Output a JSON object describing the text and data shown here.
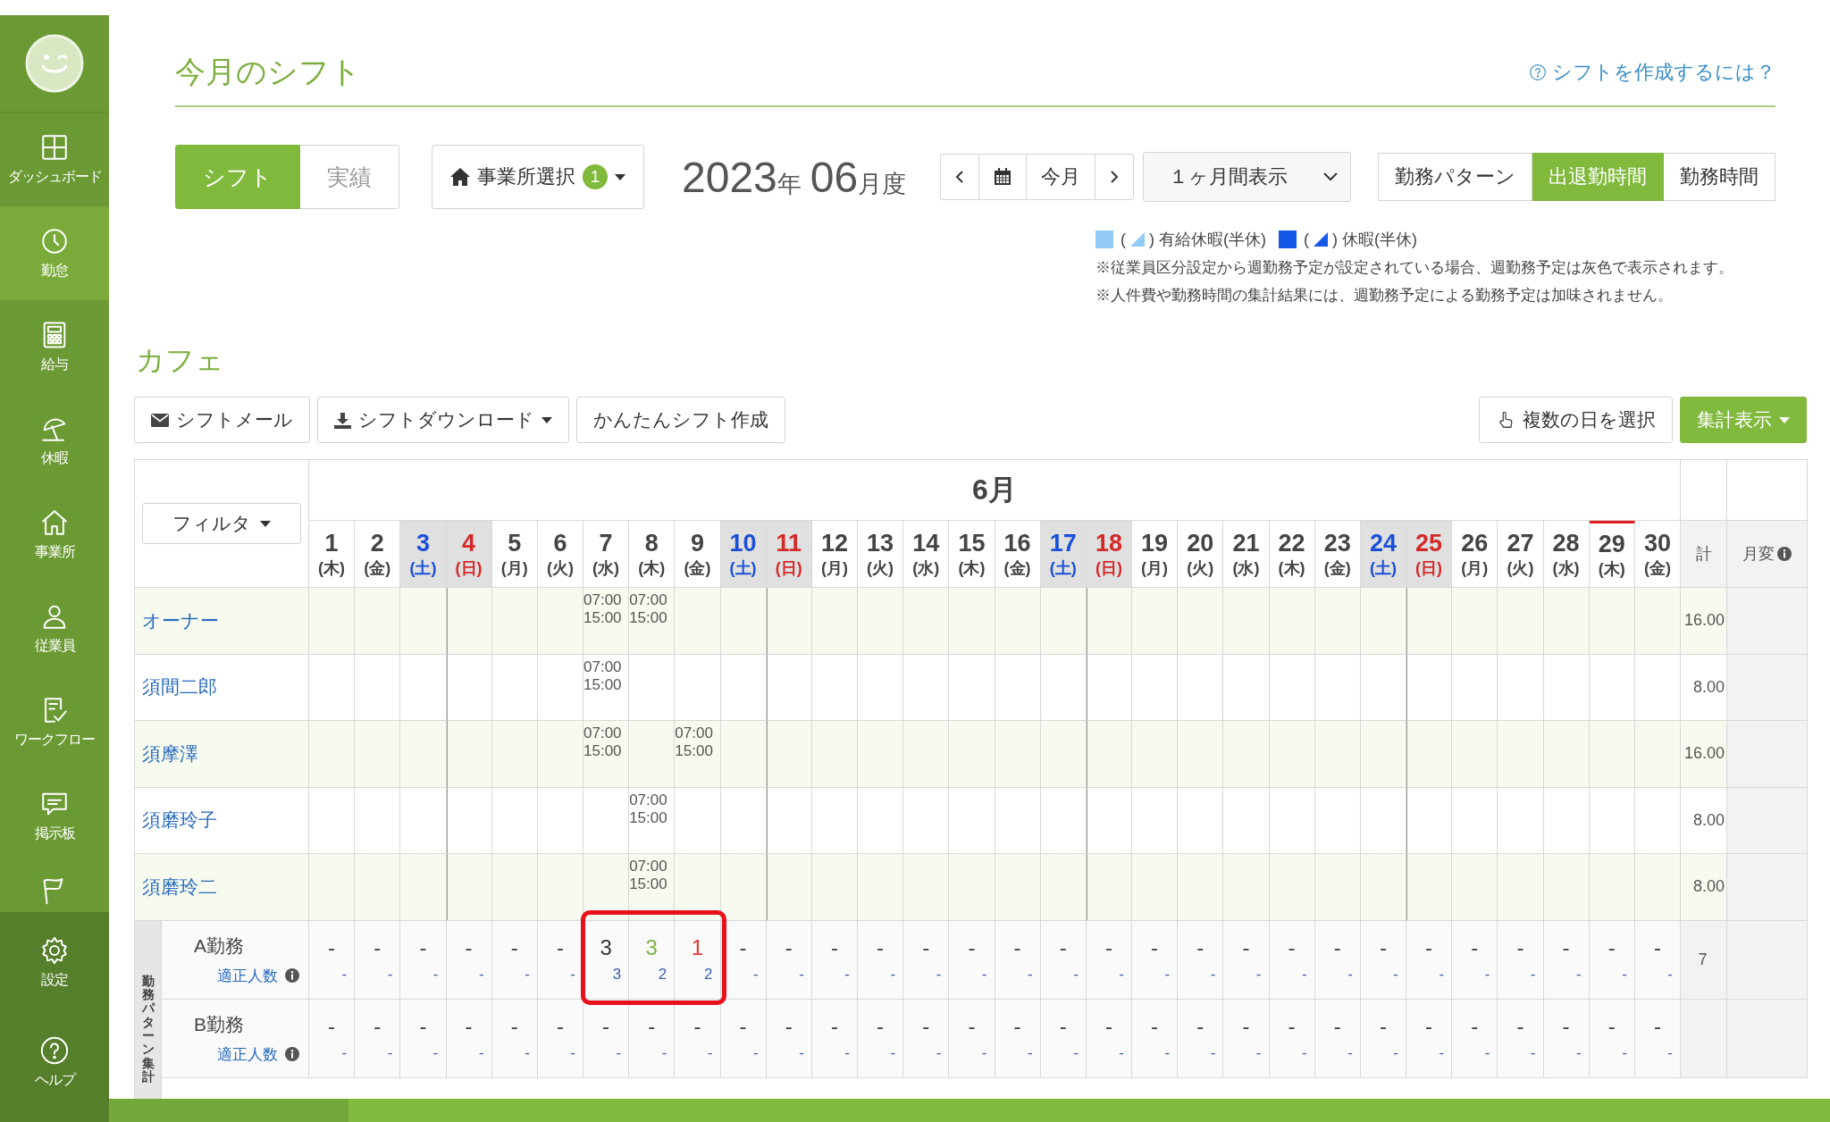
{
  "sidebar": {
    "items": [
      {
        "label": "ダッシュボード",
        "selected": false
      },
      {
        "label": "勤怠",
        "selected": true
      },
      {
        "label": "給与",
        "selected": false
      },
      {
        "label": "休暇",
        "selected": false
      },
      {
        "label": "事業所",
        "selected": false
      },
      {
        "label": "従業員",
        "selected": false
      },
      {
        "label": "ワークフロー",
        "selected": false
      },
      {
        "label": "掲示板",
        "selected": false
      },
      {
        "selected": false
      }
    ],
    "bottom_items": [
      {
        "label": "設定"
      },
      {
        "label": "ヘルプ"
      }
    ]
  },
  "header": {
    "title": "今月のシフト",
    "help_link": "シフトを作成するには？"
  },
  "toolbar": {
    "view_tabs": [
      {
        "label": "シフト",
        "selected": true
      },
      {
        "label": "実績",
        "selected": false
      }
    ],
    "office_select": {
      "label": "事業所選択",
      "badge": "1"
    },
    "period": {
      "year": "2023",
      "year_unit": "年",
      "month": "06",
      "month_unit": "月度"
    },
    "today_button": "今月",
    "range_select": "１ヶ月間表示",
    "display_tabs": [
      {
        "label": "勤務パターン",
        "selected": false
      },
      {
        "label": "出退勤時間",
        "selected": true
      },
      {
        "label": "勤務時間",
        "selected": false
      }
    ]
  },
  "legend": {
    "items": [
      {
        "color": "#92cbf5",
        "before": "(",
        "after": ") 有給休暇(半休)"
      },
      {
        "color": "#1558e8",
        "before": "(",
        "after": ") 休暇(半休)"
      }
    ],
    "notes": [
      "※従業員区分設定から週勤務予定が設定されている場合、週勤務予定は灰色で表示されます。",
      "※人件費や勤務時間の集計結果には、週勤務予定による勤務予定は加味されません。"
    ]
  },
  "section": {
    "title": "カフェ",
    "left_buttons": [
      {
        "label": "シフトメール",
        "menu": false
      },
      {
        "label": "シフトダウンロード",
        "menu": true
      },
      {
        "label": "かんたんシフト作成",
        "menu": false
      }
    ],
    "right_buttons": [
      {
        "label": "複数の日を選択",
        "menu": false,
        "primary": false
      },
      {
        "label": "集計表示",
        "menu": true,
        "primary": true
      }
    ]
  },
  "table": {
    "filter_button": "フィルタ",
    "month_title": "6月",
    "total_header": "計",
    "monthly_change_header": "月変",
    "days": [
      {
        "date": "1",
        "weekday": "(木)",
        "kind": "weekday",
        "today": false
      },
      {
        "date": "2",
        "weekday": "(金)",
        "kind": "weekday",
        "today": false
      },
      {
        "date": "3",
        "weekday": "(土)",
        "kind": "saturday",
        "today": false
      },
      {
        "date": "4",
        "weekday": "(日)",
        "kind": "sunday",
        "today": false
      },
      {
        "date": "5",
        "weekday": "(月)",
        "kind": "weekday",
        "today": false
      },
      {
        "date": "6",
        "weekday": "(火)",
        "kind": "weekday",
        "today": false
      },
      {
        "date": "7",
        "weekday": "(水)",
        "kind": "weekday",
        "today": false
      },
      {
        "date": "8",
        "weekday": "(木)",
        "kind": "weekday",
        "today": false
      },
      {
        "date": "9",
        "weekday": "(金)",
        "kind": "weekday",
        "today": false
      },
      {
        "date": "10",
        "weekday": "(土)",
        "kind": "saturday",
        "today": false
      },
      {
        "date": "11",
        "weekday": "(日)",
        "kind": "sunday",
        "today": false
      },
      {
        "date": "12",
        "weekday": "(月)",
        "kind": "weekday",
        "today": false
      },
      {
        "date": "13",
        "weekday": "(火)",
        "kind": "weekday",
        "today": false
      },
      {
        "date": "14",
        "weekday": "(水)",
        "kind": "weekday",
        "today": false
      },
      {
        "date": "15",
        "weekday": "(木)",
        "kind": "weekday",
        "today": false
      },
      {
        "date": "16",
        "weekday": "(金)",
        "kind": "weekday",
        "today": false
      },
      {
        "date": "17",
        "weekday": "(土)",
        "kind": "saturday",
        "today": false
      },
      {
        "date": "18",
        "weekday": "(日)",
        "kind": "sunday",
        "today": false
      },
      {
        "date": "19",
        "weekday": "(月)",
        "kind": "weekday",
        "today": false
      },
      {
        "date": "20",
        "weekday": "(火)",
        "kind": "weekday",
        "today": false
      },
      {
        "date": "21",
        "weekday": "(水)",
        "kind": "weekday",
        "today": false
      },
      {
        "date": "22",
        "weekday": "(木)",
        "kind": "weekday",
        "today": false
      },
      {
        "date": "23",
        "weekday": "(金)",
        "kind": "weekday",
        "today": false
      },
      {
        "date": "24",
        "weekday": "(土)",
        "kind": "saturday",
        "today": false
      },
      {
        "date": "25",
        "weekday": "(日)",
        "kind": "sunday",
        "today": false
      },
      {
        "date": "26",
        "weekday": "(月)",
        "kind": "weekday",
        "today": false
      },
      {
        "date": "27",
        "weekday": "(火)",
        "kind": "weekday",
        "today": false
      },
      {
        "date": "28",
        "weekday": "(水)",
        "kind": "weekday",
        "today": false
      },
      {
        "date": "29",
        "weekday": "(木)",
        "kind": "weekday",
        "today": true
      },
      {
        "date": "30",
        "weekday": "(金)",
        "kind": "weekday",
        "today": false
      }
    ],
    "employees": [
      {
        "name": "オーナー",
        "total": "16.00",
        "shifts": [
          {
            "kind": "empty"
          },
          {
            "kind": "empty"
          },
          {
            "kind": "empty"
          },
          {
            "kind": "empty"
          },
          {
            "kind": "empty"
          },
          {
            "kind": "empty"
          },
          {
            "kind": "shift",
            "start": "07:00",
            "end": "15:00"
          },
          {
            "kind": "shift",
            "start": "07:00",
            "end": "15:00"
          },
          {
            "kind": "empty"
          },
          {
            "kind": "empty"
          },
          {
            "kind": "empty"
          },
          {
            "kind": "empty"
          },
          {
            "kind": "empty"
          },
          {
            "kind": "empty"
          },
          {
            "kind": "empty"
          },
          {
            "kind": "empty"
          },
          {
            "kind": "empty"
          },
          {
            "kind": "empty"
          },
          {
            "kind": "empty"
          },
          {
            "kind": "empty"
          },
          {
            "kind": "empty"
          },
          {
            "kind": "empty"
          },
          {
            "kind": "empty"
          },
          {
            "kind": "empty"
          },
          {
            "kind": "empty"
          },
          {
            "kind": "empty"
          },
          {
            "kind": "empty"
          },
          {
            "kind": "empty"
          },
          {
            "kind": "empty"
          },
          {
            "kind": "empty"
          }
        ]
      },
      {
        "name": "須間二郎",
        "total": "8.00",
        "shifts": [
          {
            "kind": "empty"
          },
          {
            "kind": "empty"
          },
          {
            "kind": "empty"
          },
          {
            "kind": "empty"
          },
          {
            "kind": "empty"
          },
          {
            "kind": "empty"
          },
          {
            "kind": "shift",
            "start": "07:00",
            "end": "15:00"
          },
          {
            "kind": "empty"
          },
          {
            "kind": "empty"
          },
          {
            "kind": "empty"
          },
          {
            "kind": "empty"
          },
          {
            "kind": "empty"
          },
          {
            "kind": "empty"
          },
          {
            "kind": "empty"
          },
          {
            "kind": "empty"
          },
          {
            "kind": "empty"
          },
          {
            "kind": "empty"
          },
          {
            "kind": "empty"
          },
          {
            "kind": "empty"
          },
          {
            "kind": "empty"
          },
          {
            "kind": "empty"
          },
          {
            "kind": "empty"
          },
          {
            "kind": "empty"
          },
          {
            "kind": "empty"
          },
          {
            "kind": "empty"
          },
          {
            "kind": "empty"
          },
          {
            "kind": "empty"
          },
          {
            "kind": "empty"
          },
          {
            "kind": "empty"
          },
          {
            "kind": "empty"
          }
        ]
      },
      {
        "name": "須摩澤",
        "total": "16.00",
        "shifts": [
          {
            "kind": "empty"
          },
          {
            "kind": "empty"
          },
          {
            "kind": "empty"
          },
          {
            "kind": "empty"
          },
          {
            "kind": "empty"
          },
          {
            "kind": "empty"
          },
          {
            "kind": "shift",
            "start": "07:00",
            "end": "15:00"
          },
          {
            "kind": "empty"
          },
          {
            "kind": "shift",
            "start": "07:00",
            "end": "15:00"
          },
          {
            "kind": "empty"
          },
          {
            "kind": "empty"
          },
          {
            "kind": "empty"
          },
          {
            "kind": "empty"
          },
          {
            "kind": "empty"
          },
          {
            "kind": "empty"
          },
          {
            "kind": "empty"
          },
          {
            "kind": "empty"
          },
          {
            "kind": "empty"
          },
          {
            "kind": "empty"
          },
          {
            "kind": "empty"
          },
          {
            "kind": "empty"
          },
          {
            "kind": "empty"
          },
          {
            "kind": "empty"
          },
          {
            "kind": "empty"
          },
          {
            "kind": "empty"
          },
          {
            "kind": "empty"
          },
          {
            "kind": "empty"
          },
          {
            "kind": "empty"
          },
          {
            "kind": "empty"
          },
          {
            "kind": "empty"
          }
        ]
      },
      {
        "name": "須磨玲子",
        "total": "8.00",
        "shifts": [
          {
            "kind": "empty"
          },
          {
            "kind": "empty"
          },
          {
            "kind": "empty"
          },
          {
            "kind": "empty"
          },
          {
            "kind": "empty"
          },
          {
            "kind": "empty"
          },
          {
            "kind": "empty"
          },
          {
            "kind": "shift",
            "start": "07:00",
            "end": "15:00"
          },
          {
            "kind": "empty"
          },
          {
            "kind": "empty"
          },
          {
            "kind": "empty"
          },
          {
            "kind": "empty"
          },
          {
            "kind": "empty"
          },
          {
            "kind": "empty"
          },
          {
            "kind": "empty"
          },
          {
            "kind": "empty"
          },
          {
            "kind": "empty"
          },
          {
            "kind": "empty"
          },
          {
            "kind": "empty"
          },
          {
            "kind": "empty"
          },
          {
            "kind": "empty"
          },
          {
            "kind": "empty"
          },
          {
            "kind": "empty"
          },
          {
            "kind": "empty"
          },
          {
            "kind": "empty"
          },
          {
            "kind": "empty"
          },
          {
            "kind": "empty"
          },
          {
            "kind": "empty"
          },
          {
            "kind": "empty"
          },
          {
            "kind": "empty"
          }
        ]
      },
      {
        "name": "須磨玲二",
        "total": "8.00",
        "shifts": [
          {
            "kind": "empty"
          },
          {
            "kind": "empty"
          },
          {
            "kind": "empty"
          },
          {
            "kind": "empty"
          },
          {
            "kind": "empty"
          },
          {
            "kind": "empty"
          },
          {
            "kind": "empty"
          },
          {
            "kind": "shift",
            "start": "07:00",
            "end": "15:00"
          },
          {
            "kind": "empty"
          },
          {
            "kind": "empty"
          },
          {
            "kind": "empty"
          },
          {
            "kind": "empty"
          },
          {
            "kind": "empty"
          },
          {
            "kind": "empty"
          },
          {
            "kind": "empty"
          },
          {
            "kind": "empty"
          },
          {
            "kind": "empty"
          },
          {
            "kind": "empty"
          },
          {
            "kind": "empty"
          },
          {
            "kind": "empty"
          },
          {
            "kind": "empty"
          },
          {
            "kind": "empty"
          },
          {
            "kind": "empty"
          },
          {
            "kind": "empty"
          },
          {
            "kind": "empty"
          },
          {
            "kind": "empty"
          },
          {
            "kind": "empty"
          },
          {
            "kind": "empty"
          },
          {
            "kind": "empty"
          },
          {
            "kind": "empty"
          }
        ]
      }
    ],
    "pattern_group": {
      "title": "勤務パターン集計",
      "rows": [
        {
          "name": "A勤務",
          "sub_label": "適正人数",
          "total": "7",
          "cells": [
            {
              "count": "-",
              "required": "-",
              "kind": "none",
              "highlighted": false
            },
            {
              "count": "-",
              "required": "-",
              "kind": "none",
              "highlighted": false
            },
            {
              "count": "-",
              "required": "-",
              "kind": "none",
              "highlighted": false
            },
            {
              "count": "-",
              "required": "-",
              "kind": "none",
              "highlighted": false
            },
            {
              "count": "-",
              "required": "-",
              "kind": "none",
              "highlighted": false
            },
            {
              "count": "-",
              "required": "-",
              "kind": "none",
              "highlighted": false
            },
            {
              "count": "3",
              "required": "3",
              "kind": "normal",
              "highlighted": true
            },
            {
              "count": "3",
              "required": "2",
              "kind": "over",
              "highlighted": true
            },
            {
              "count": "1",
              "required": "2",
              "kind": "short",
              "highlighted": true
            },
            {
              "count": "-",
              "required": "-",
              "kind": "none",
              "highlighted": false
            },
            {
              "count": "-",
              "required": "-",
              "kind": "none",
              "highlighted": false
            },
            {
              "count": "-",
              "required": "-",
              "kind": "none",
              "highlighted": false
            },
            {
              "count": "-",
              "required": "-",
              "kind": "none",
              "highlighted": false
            },
            {
              "count": "-",
              "required": "-",
              "kind": "none",
              "highlighted": false
            },
            {
              "count": "-",
              "required": "-",
              "kind": "none",
              "highlighted": false
            },
            {
              "count": "-",
              "required": "-",
              "kind": "none",
              "highlighted": false
            },
            {
              "count": "-",
              "required": "-",
              "kind": "none",
              "highlighted": false
            },
            {
              "count": "-",
              "required": "-",
              "kind": "none",
              "highlighted": false
            },
            {
              "count": "-",
              "required": "-",
              "kind": "none",
              "highlighted": false
            },
            {
              "count": "-",
              "required": "-",
              "kind": "none",
              "highlighted": false
            },
            {
              "count": "-",
              "required": "-",
              "kind": "none",
              "highlighted": false
            },
            {
              "count": "-",
              "required": "-",
              "kind": "none",
              "highlighted": false
            },
            {
              "count": "-",
              "required": "-",
              "kind": "none",
              "highlighted": false
            },
            {
              "count": "-",
              "required": "-",
              "kind": "none",
              "highlighted": false
            },
            {
              "count": "-",
              "required": "-",
              "kind": "none",
              "highlighted": false
            },
            {
              "count": "-",
              "required": "-",
              "kind": "none",
              "highlighted": false
            },
            {
              "count": "-",
              "required": "-",
              "kind": "none",
              "highlighted": false
            },
            {
              "count": "-",
              "required": "-",
              "kind": "none",
              "highlighted": false
            },
            {
              "count": "-",
              "required": "-",
              "kind": "none",
              "highlighted": false
            },
            {
              "count": "-",
              "required": "-",
              "kind": "none",
              "highlighted": false
            }
          ]
        },
        {
          "name": "B勤務",
          "sub_label": "適正人数",
          "cells": [
            {
              "count": "-",
              "required": "-",
              "kind": "none",
              "highlighted": false
            },
            {
              "count": "-",
              "required": "-",
              "kind": "none",
              "highlighted": false
            },
            {
              "count": "-",
              "required": "-",
              "kind": "none",
              "highlighted": false
            },
            {
              "count": "-",
              "required": "-",
              "kind": "none",
              "highlighted": false
            },
            {
              "count": "-",
              "required": "-",
              "kind": "none",
              "highlighted": false
            },
            {
              "count": "-",
              "required": "-",
              "kind": "none",
              "highlighted": false
            },
            {
              "count": "-",
              "required": "-",
              "kind": "none",
              "highlighted": false
            },
            {
              "count": "-",
              "required": "-",
              "kind": "none",
              "highlighted": false
            },
            {
              "count": "-",
              "required": "-",
              "kind": "none",
              "highlighted": false
            },
            {
              "count": "-",
              "required": "-",
              "kind": "none",
              "highlighted": false
            },
            {
              "count": "-",
              "required": "-",
              "kind": "none",
              "highlighted": false
            },
            {
              "count": "-",
              "required": "-",
              "kind": "none",
              "highlighted": false
            },
            {
              "count": "-",
              "required": "-",
              "kind": "none",
              "highlighted": false
            },
            {
              "count": "-",
              "required": "-",
              "kind": "none",
              "highlighted": false
            },
            {
              "count": "-",
              "required": "-",
              "kind": "none",
              "highlighted": false
            },
            {
              "count": "-",
              "required": "-",
              "kind": "none",
              "highlighted": false
            },
            {
              "count": "-",
              "required": "-",
              "kind": "none",
              "highlighted": false
            },
            {
              "count": "-",
              "required": "-",
              "kind": "none",
              "highlighted": false
            },
            {
              "count": "-",
              "required": "-",
              "kind": "none",
              "highlighted": false
            },
            {
              "count": "-",
              "required": "-",
              "kind": "none",
              "highlighted": false
            },
            {
              "count": "-",
              "required": "-",
              "kind": "none",
              "highlighted": false
            },
            {
              "count": "-",
              "required": "-",
              "kind": "none",
              "highlighted": false
            },
            {
              "count": "-",
              "required": "-",
              "kind": "none",
              "highlighted": false
            },
            {
              "count": "-",
              "required": "-",
              "kind": "none",
              "highlighted": false
            },
            {
              "count": "-",
              "required": "-",
              "kind": "none",
              "highlighted": false
            },
            {
              "count": "-",
              "required": "-",
              "kind": "none",
              "highlighted": false
            },
            {
              "count": "-",
              "required": "-",
              "kind": "none",
              "highlighted": false
            },
            {
              "count": "-",
              "required": "-",
              "kind": "none",
              "highlighted": false
            },
            {
              "count": "-",
              "required": "-",
              "kind": "none",
              "highlighted": false
            },
            {
              "count": "-",
              "required": "-",
              "kind": "none",
              "highlighted": false
            }
          ]
        }
      ]
    }
  }
}
